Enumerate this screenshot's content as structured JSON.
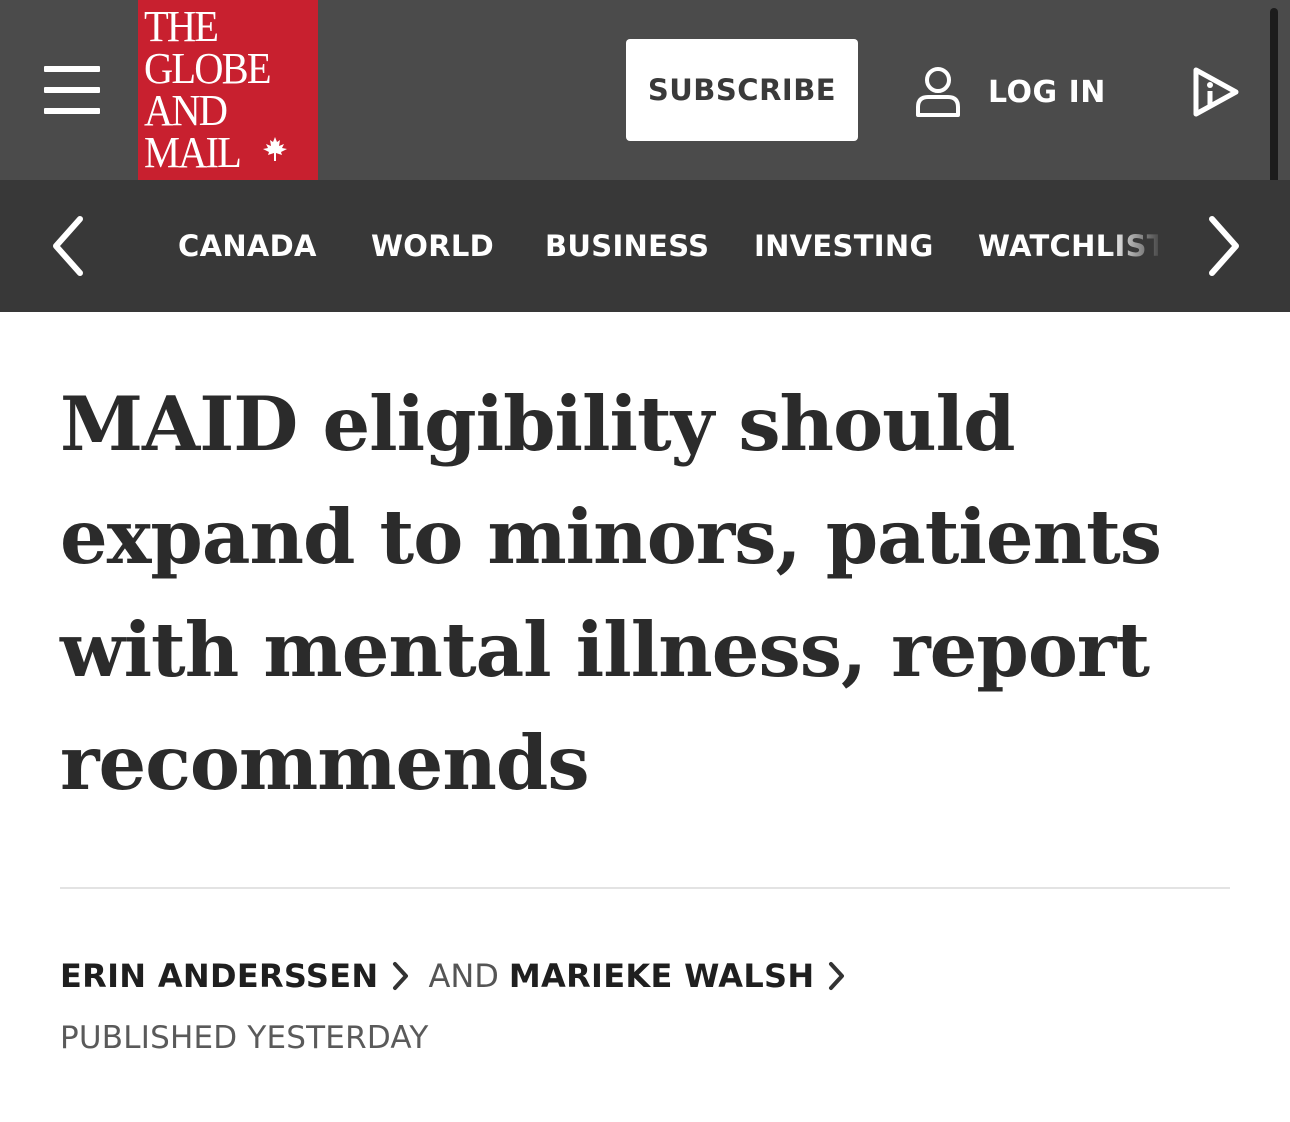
{
  "header": {
    "logo_lines": [
      "THE",
      "GLOBE",
      "AND",
      "MAIL"
    ],
    "subscribe_label": "SUBSCRIBE",
    "login_label": "LOG IN",
    "brand_color": "#c8202f"
  },
  "nav": {
    "items": [
      "CANADA",
      "WORLD",
      "BUSINESS",
      "INVESTING",
      "WATCHLIST"
    ]
  },
  "article": {
    "headline": "MAID eligibility should expand to minors, patients with mental illness, report recommends",
    "authors": [
      "ERIN ANDERSSEN",
      "MARIEKE WALSH"
    ],
    "conjunction": "AND",
    "published": "PUBLISHED YESTERDAY"
  },
  "icons": {
    "menu": "hamburger-menu-icon",
    "login": "user-icon",
    "video": "play-video-icon",
    "nav_prev": "chevron-left-icon",
    "nav_next": "chevron-right-icon",
    "leaf": "maple-leaf-icon"
  }
}
